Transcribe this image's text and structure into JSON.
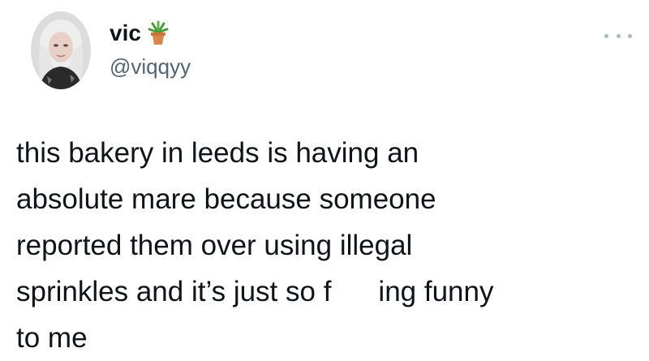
{
  "author": {
    "display_name": "vic",
    "handle": "@viqqyy",
    "name_emoji": "potted-plant-icon"
  },
  "tweet": {
    "lines": [
      "this bakery in leeds is having an",
      "absolute mare because someone",
      "reported them over using illegal",
      "sprinkles and it’s just so f",
      "ing funny",
      "to me"
    ]
  },
  "menu": {
    "icon": "more-options-icon"
  },
  "colors": {
    "text": "#0f1419",
    "handle": "#536471",
    "dots": "#aab8c2"
  }
}
